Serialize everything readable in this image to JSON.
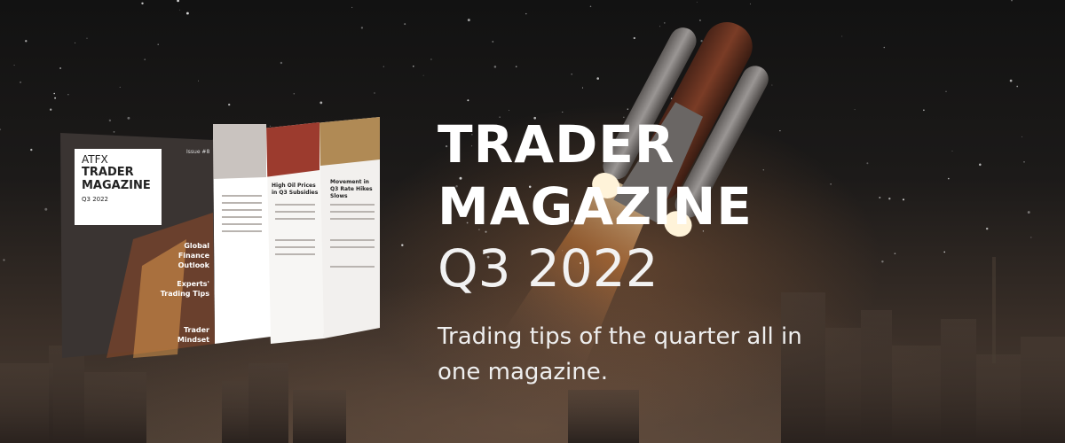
{
  "banner": {
    "title": "TRADER MAGAZINE",
    "subtitle": "Q3 2022",
    "tagline": "Trading tips of the quarter all in one magazine."
  },
  "magazine": {
    "brand": "ATFX",
    "name_line1": "TRADER",
    "name_line2": "MAGAZINE",
    "issue": "Q3 2022",
    "issue_no": "Issue #8",
    "cover_items": [
      "Global Finance Outlook",
      "Experts' Trading Tips",
      "Trader Mindset"
    ],
    "page_headlines": [
      "High Oil Prices in Q3 Subsidies",
      "Movement in Q3 Rate Hikes Slows"
    ]
  },
  "colors": {
    "accent": "#ffffff",
    "flame": "#e8893a",
    "sky": "#151313"
  }
}
